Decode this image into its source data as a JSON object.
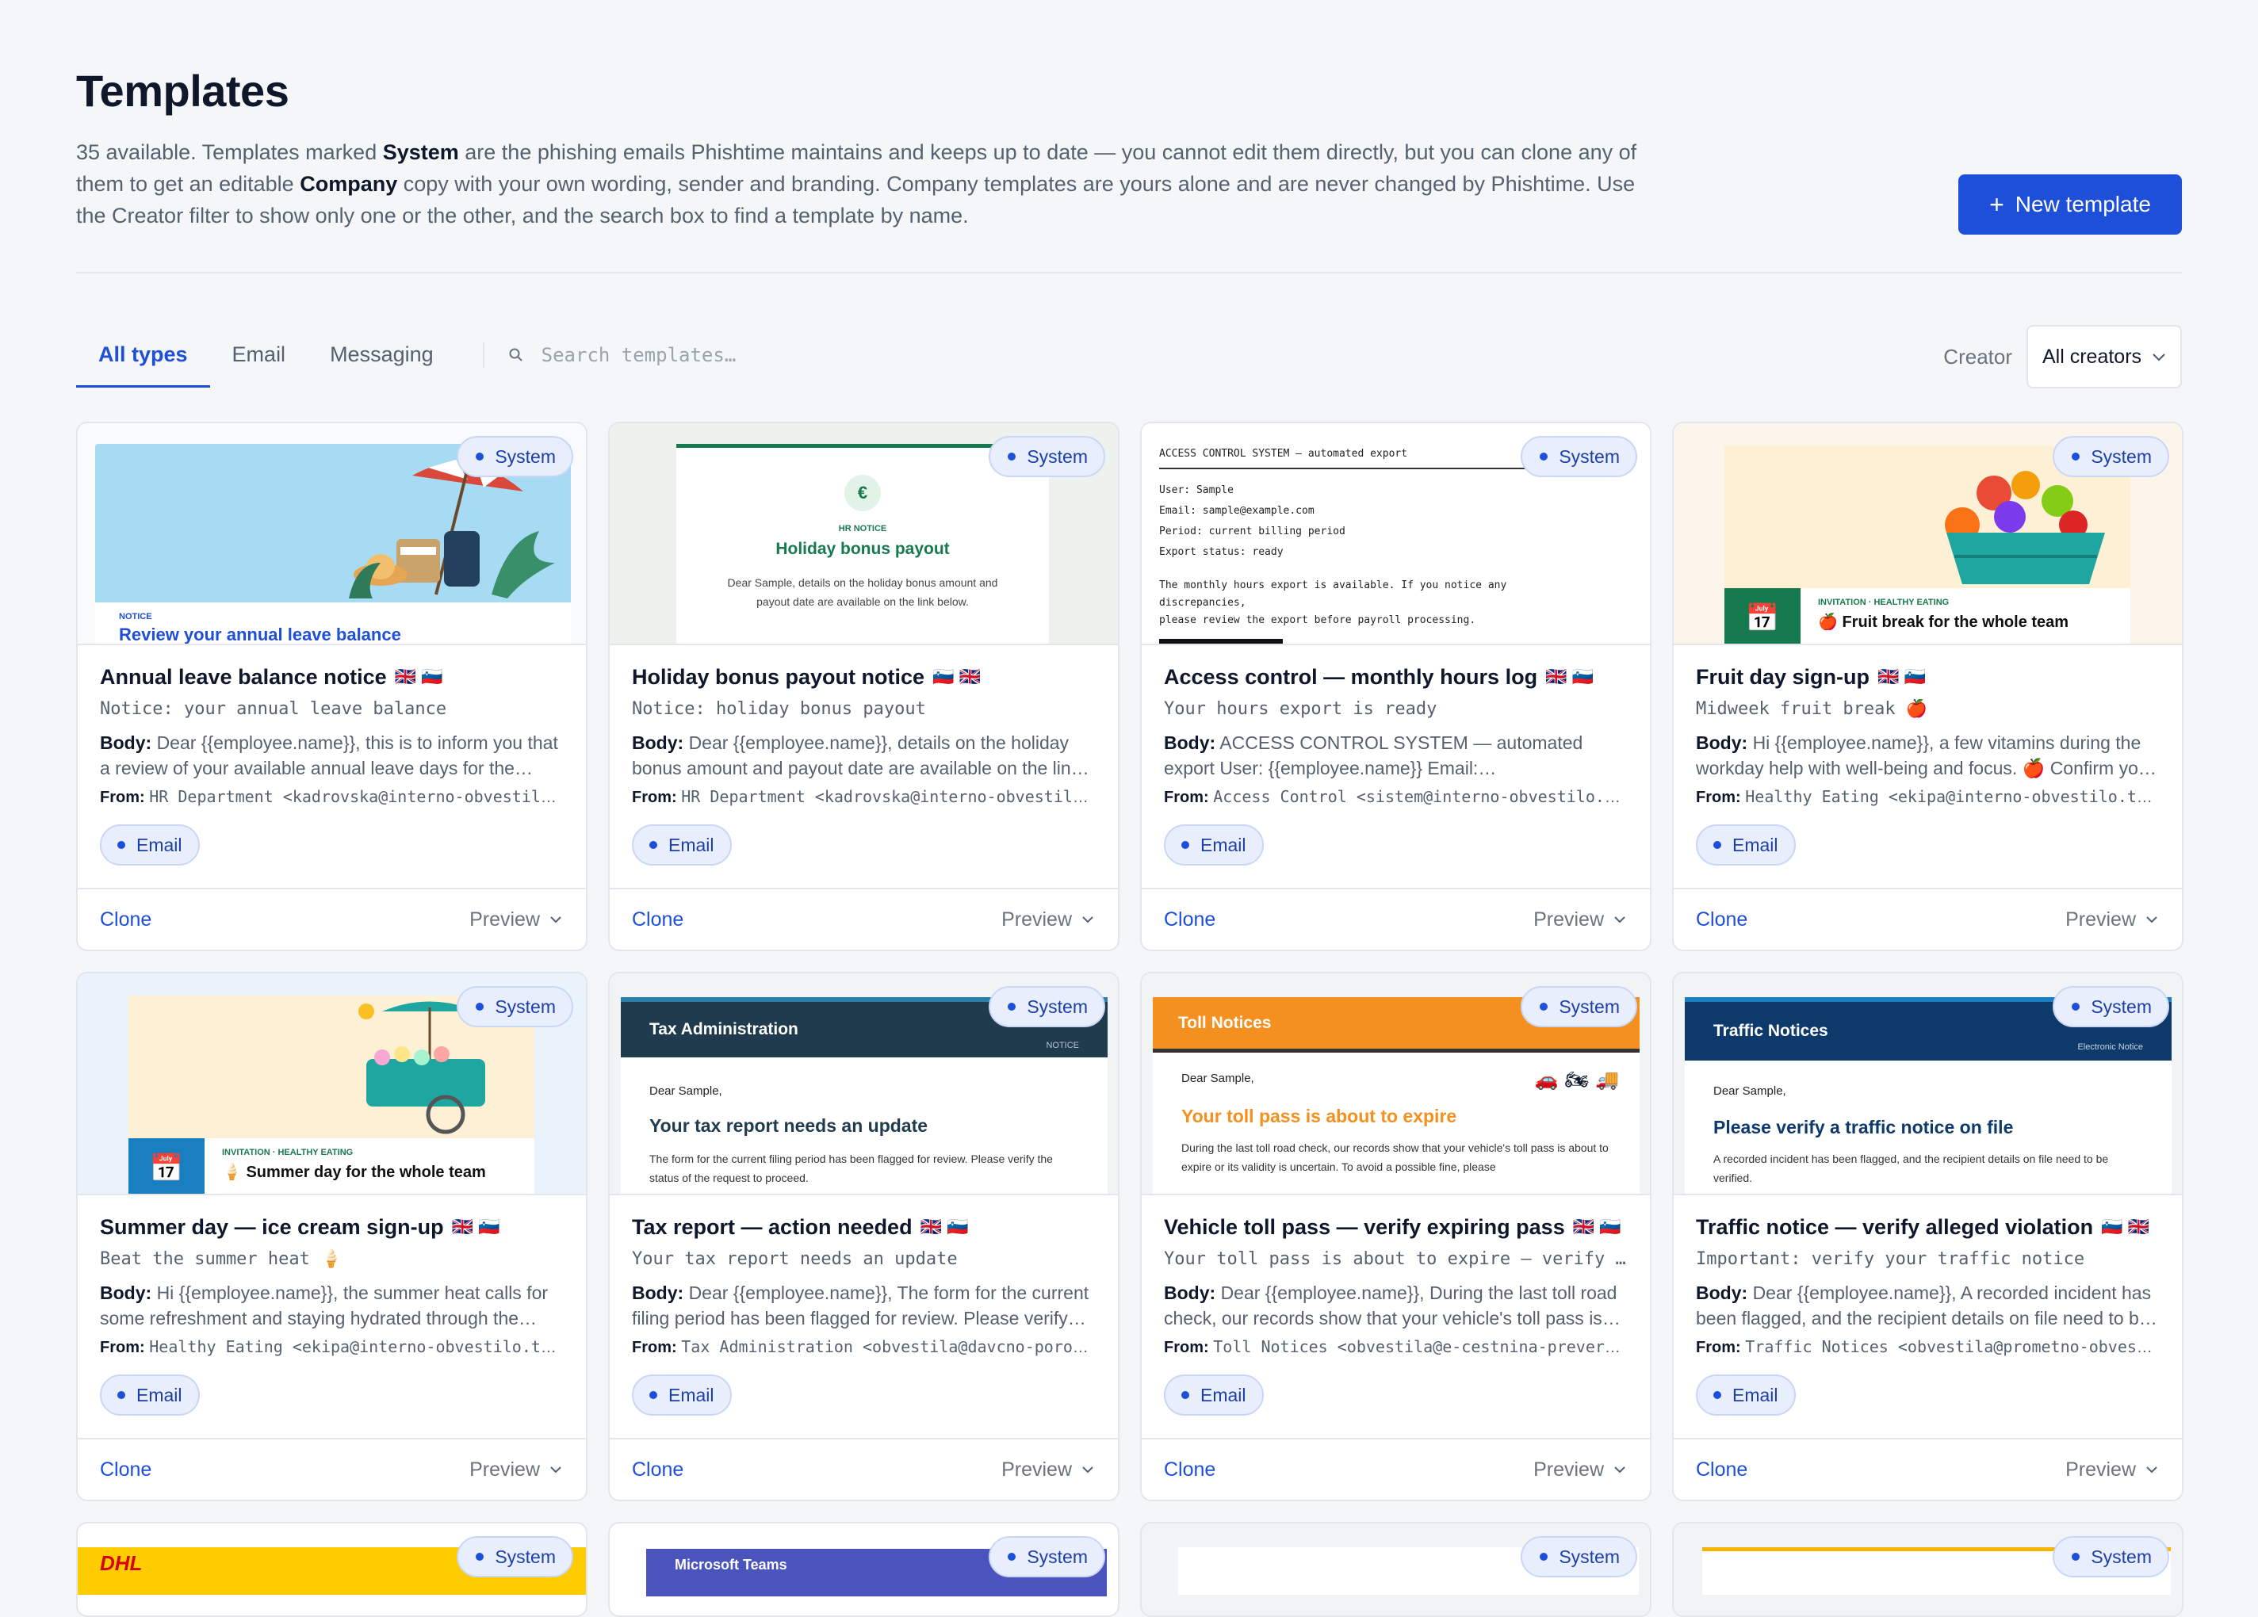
{
  "header": {
    "title": "Templates",
    "desc_1": "35 available. Templates marked ",
    "desc_b1": "System",
    "desc_2": " are the phishing emails Phishtime maintains and keeps up to date — you cannot edit them directly, but you can clone any of them to get an editable ",
    "desc_b2": "Company",
    "desc_3": " copy with your own wording, sender and branding. Company templates are yours alone and are never changed by Phishtime. Use the Creator filter to show only one or the other, and the search box to find a template by name.",
    "new_button": "New template"
  },
  "filters": {
    "tabs": [
      "All types",
      "Email",
      "Messaging"
    ],
    "search_placeholder": "Search templates…",
    "creator_label": "Creator",
    "creator_value": "All creators"
  },
  "common": {
    "system": "System",
    "email": "Email",
    "clone": "Clone",
    "preview": "Preview",
    "body_label": "Body:",
    "from_label": "From:"
  },
  "cards": [
    {
      "title": "Annual leave balance notice",
      "flags": "🇬🇧 🇸🇮",
      "subject": "Notice: your annual leave balance",
      "body": "Dear {{employee.name}}, this is to inform you that a review of your available annual leave days for the current period has been completed.",
      "from": "HR Department <kadrovska@interno-obvestilo.com>",
      "thumb": {
        "label": "NOTICE",
        "title": "Review your annual leave balance"
      }
    },
    {
      "title": "Holiday bonus payout notice",
      "flags": "🇸🇮 🇬🇧",
      "subject": "Notice: holiday bonus payout",
      "body": "Dear {{employee.name}}, details on the holiday bonus amount and payout date are available on the link below.",
      "from": "HR Department <kadrovska@interno-obvestilo.com>",
      "thumb": {
        "label": "HR NOTICE",
        "title": "Holiday bonus payout",
        "text": "Dear Sample, details on the holiday bonus amount and payout date are available on the link below.",
        "icon": "€"
      }
    },
    {
      "title": "Access control — monthly hours log",
      "flags": "🇬🇧 🇸🇮",
      "subject": "Your hours export is ready",
      "body": "ACCESS CONTROL SYSTEM — automated export User: {{employee.name}} Email: {{employee.email}} Period: current billing period",
      "from": "Access Control <sistem@interno-obvestilo.com>",
      "thumb": {
        "lines": [
          "ACCESS CONTROL SYSTEM — automated export",
          "User: Sample",
          "Email: sample@example.com",
          "Period: current billing period",
          "Export status: ready",
          "The monthly hours export is available. If you notice any discrepancies,",
          "please review the export before payroll processing."
        ]
      }
    },
    {
      "title": "Fruit day sign-up",
      "flags": "🇬🇧 🇸🇮",
      "subject": "Midweek fruit break 🍎",
      "body": "Hi {{employee.name}}, a few vitamins during the workday help with well-being and focus. 🍎 Confirm your spot below.",
      "from": "Healthy Eating <ekipa@interno-obvestilo.team>",
      "thumb": {
        "label": "INVITATION · HEALTHY EATING",
        "title": "🍎 Fruit break for the whole team"
      }
    },
    {
      "title": "Summer day — ice cream sign-up",
      "flags": "🇬🇧 🇸🇮",
      "subject": "Beat the summer heat 🍦",
      "body": "Hi {{employee.name}}, the summer heat calls for some refreshment and staying hydrated through the afternoon.",
      "from": "Healthy Eating <ekipa@interno-obvestilo.team>",
      "thumb": {
        "label": "INVITATION · HEALTHY EATING",
        "title": "🍦 Summer day for the whole team"
      }
    },
    {
      "title": "Tax report — action needed",
      "flags": "🇬🇧 🇸🇮",
      "subject": "Your tax report needs an update",
      "body": "Dear {{employee.name}}, The form for the current filing period has been flagged for review. Please verify the status of the request.",
      "from": "Tax Administration <obvestila@davcno-porocilo.com>",
      "thumb": {
        "brand": "Tax Administration",
        "tag": "NOTICE",
        "greeting": "Dear Sample,",
        "title": "Your tax report needs an update",
        "text": "The form for the current filing period has been flagged for review. Please verify the status of the request to proceed."
      }
    },
    {
      "title": "Vehicle toll pass — verify expiring pass",
      "flags": "🇬🇧 🇸🇮",
      "subject": "Your toll pass is about to expire — verify now",
      "body": "Dear {{employee.name}}, During the last toll road check, our records show that your vehicle's toll pass is about to expire.",
      "from": "Toll Notices <obvestila@e-cestnina-preverjanje.com>",
      "thumb": {
        "brand": "Toll Notices",
        "greeting": "Dear Sample,",
        "title": "Your toll pass is about to expire",
        "text": "During the last toll road check, our records show that your vehicle's toll pass is about to expire or its validity is uncertain. To avoid a possible fine, please"
      }
    },
    {
      "title": "Traffic notice — verify alleged violation",
      "flags": "🇸🇮 🇬🇧",
      "subject": "Important: verify your traffic notice",
      "body": "Dear {{employee.name}}, A recorded incident has been flagged, and the recipient details on file need to be verified.",
      "from": "Traffic Notices <obvestila@prometno-obvestilo.com>",
      "thumb": {
        "brand": "Traffic Notices",
        "tag": "Electronic Notice",
        "greeting": "Dear Sample,",
        "title": "Please verify a traffic notice on file",
        "text": "A recorded incident has been flagged, and the recipient details on file need to be verified."
      }
    }
  ],
  "row3": {
    "dhl": "DHL",
    "teams": "Microsoft Teams"
  }
}
